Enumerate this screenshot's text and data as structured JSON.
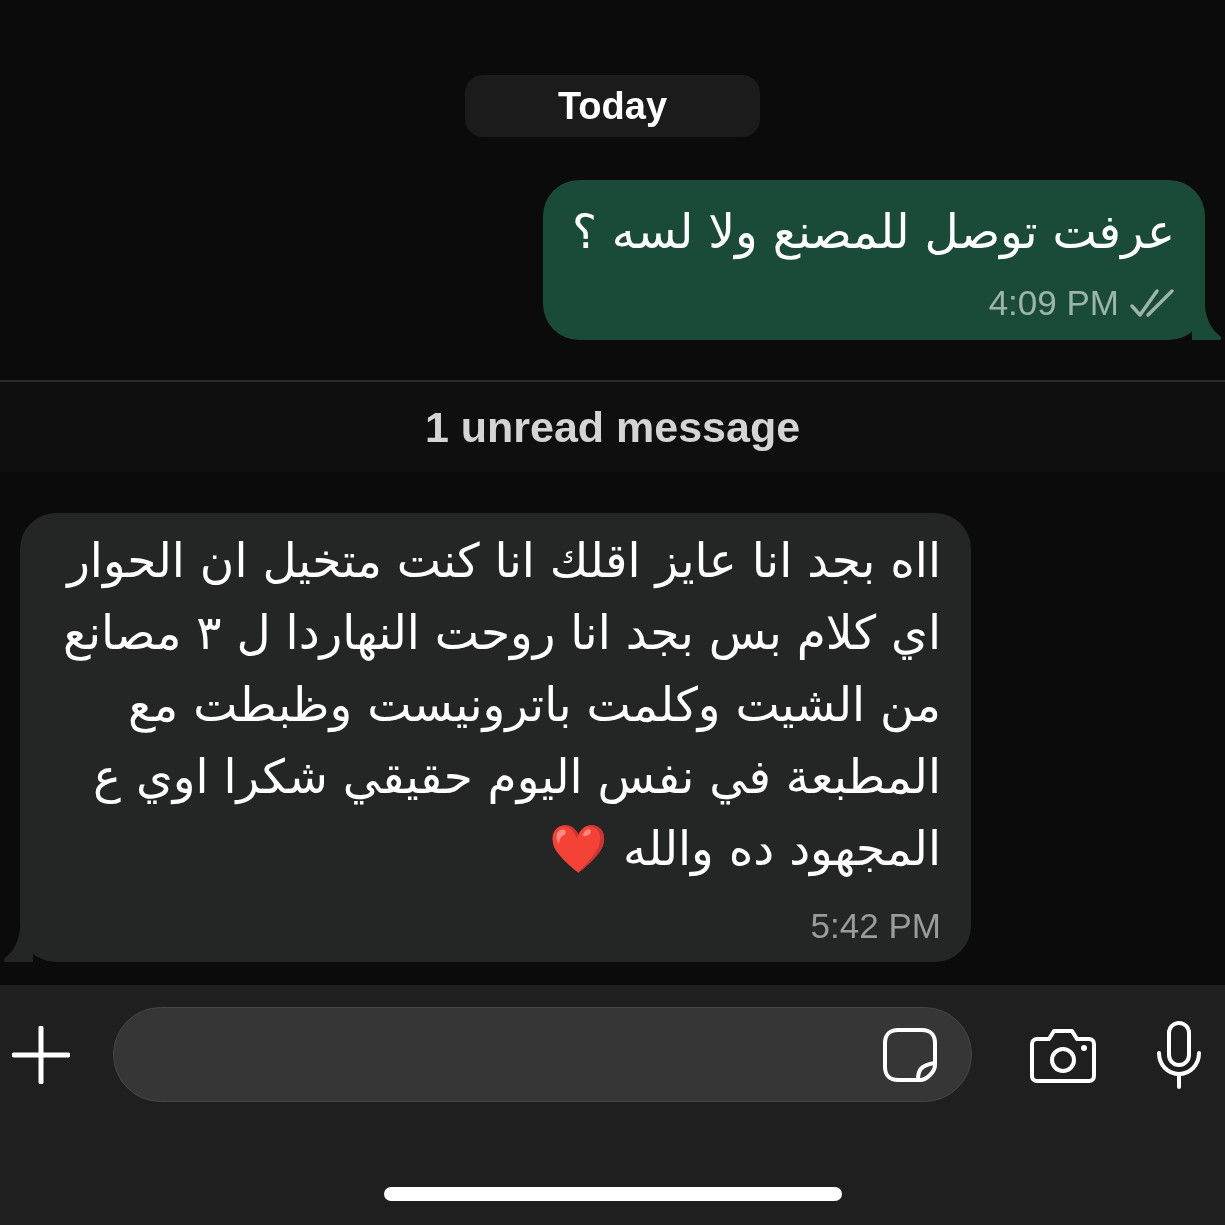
{
  "conversation": [
    {
      "kind": "date",
      "label": "Today"
    },
    {
      "kind": "outgoing",
      "text": "عرفت توصل للمصنع ولا لسه ؟",
      "time": "4:09 PM",
      "read": false
    },
    {
      "kind": "unread",
      "label": "1 unread message"
    },
    {
      "kind": "incoming",
      "text": "ااه بجد انا عايز اقلك انا كنت متخيل ان الحوار\nاي كلام بس بجد انا روحت النهاردا ل ٣ مصانع\nمن الشيت وكلمت باترونيست وظبطت مع\nالمطبعة في نفس اليوم حقيقي شكرا اوي ع\nالمجهود ده والله ❤️",
      "time": "5:42 PM"
    }
  ]
}
